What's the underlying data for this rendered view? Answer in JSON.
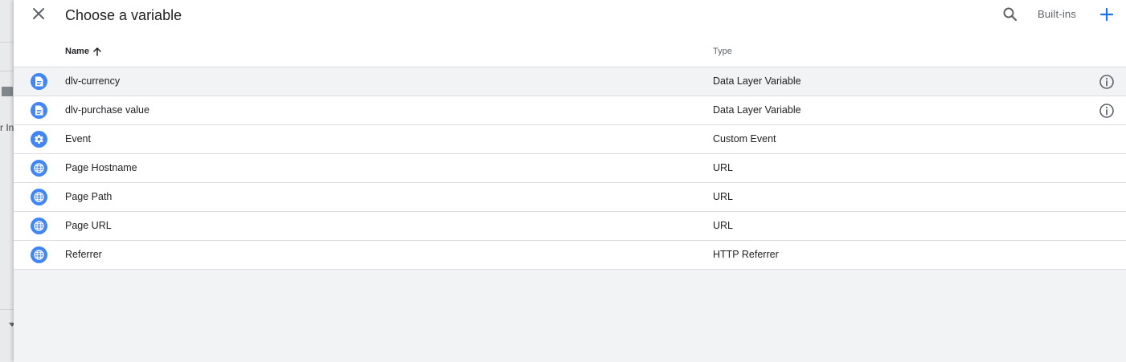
{
  "header": {
    "title": "Choose a variable",
    "builtins_label": "Built-ins"
  },
  "background": {
    "partial_text": "r In"
  },
  "table": {
    "columns": {
      "name": "Name",
      "type": "Type"
    },
    "sort": "ascending",
    "rows": [
      {
        "name": "dlv-currency",
        "type": "Data Layer Variable",
        "icon": "document-icon",
        "info": true
      },
      {
        "name": "dlv-purchase value",
        "type": "Data Layer Variable",
        "icon": "document-icon",
        "info": true
      },
      {
        "name": "Event",
        "type": "Custom Event",
        "icon": "gear-icon",
        "info": false
      },
      {
        "name": "Page Hostname",
        "type": "URL",
        "icon": "globe-icon",
        "info": false
      },
      {
        "name": "Page Path",
        "type": "URL",
        "icon": "globe-icon",
        "info": false
      },
      {
        "name": "Page URL",
        "type": "URL",
        "icon": "globe-icon",
        "info": false
      },
      {
        "name": "Referrer",
        "type": "HTTP Referrer",
        "icon": "globe-icon",
        "info": false
      }
    ]
  },
  "colors": {
    "accent": "#1a73e8",
    "icon_bg": "#4285f4",
    "panel_bg": "#f1f3f4"
  }
}
